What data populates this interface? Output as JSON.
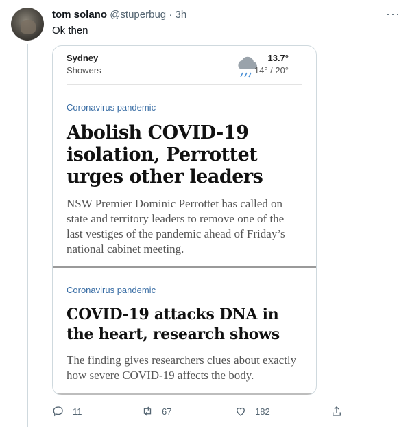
{
  "tweet": {
    "name": "tom solano",
    "handle": "@stuperbug",
    "separator": "·",
    "time": "3h",
    "text": "Ok then",
    "more": "···"
  },
  "card": {
    "weather": {
      "city": "Sydney",
      "condition": "Showers",
      "temp": "13.7°",
      "range": "14° / 20°",
      "icon": "rain-cloud-icon"
    },
    "articles": [
      {
        "tag": "Coronavirus pandemic",
        "headline": "Abolish COVID-19 isolation, Perrottet urges other leaders",
        "summary": "NSW Premier Dominic Perrottet has called on state and territory leaders to remove one of the last vestiges of the pandemic ahead of Friday’s national cabinet meeting."
      },
      {
        "tag": "Coronavirus pandemic",
        "headline": "COVID-19 attacks DNA in the heart, research shows",
        "summary": "The finding gives researchers clues about exactly how severe COVID-19 affects the body."
      }
    ]
  },
  "actions": {
    "replies": "11",
    "retweets": "67",
    "likes": "182"
  },
  "colors": {
    "tag": "#3a6ea5",
    "muted": "#536471"
  }
}
